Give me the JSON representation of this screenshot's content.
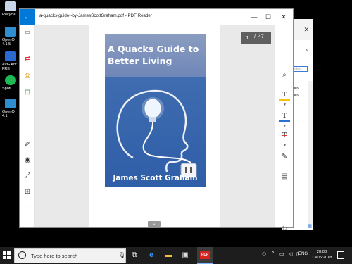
{
  "desktop": {
    "icons": [
      {
        "label": "Recycle",
        "color": "#c8d6e8"
      },
      {
        "label": "OpenO 4.1.5",
        "color": "#2e8ece"
      },
      {
        "label": "AVG Ant FRE",
        "color": "#2b6bd0"
      },
      {
        "label": "Spoti",
        "color": "#1db954"
      },
      {
        "label": "OpenO 4.1.",
        "color": "#2e8ece"
      }
    ]
  },
  "background_window": {
    "close": "✕",
    "arrow": "∨",
    "search_placeholder": "etter...",
    "rows": [
      "1 KB",
      "4 KB"
    ]
  },
  "pdf_window": {
    "back_glyph": "←",
    "title": "a-quacks-guide--by-JamesScottGraham.pdf - PDF Reader",
    "minimize": "—",
    "maximize": "☐",
    "close": "✕",
    "page_current": "1",
    "page_separator": "/",
    "page_total": "47",
    "scroll_handle": "⌄",
    "left_tools": [
      {
        "name": "thumbnail-icon",
        "glyph": "▭"
      },
      {
        "name": "convert-icon",
        "glyph": "⇄"
      },
      {
        "name": "print-icon",
        "glyph": "⎙"
      },
      {
        "name": "share-icon",
        "glyph": "⊡"
      },
      {
        "name": "annotate-icon",
        "glyph": "✐"
      },
      {
        "name": "view-icon",
        "glyph": "◉"
      },
      {
        "name": "expand-icon",
        "glyph": "⤢"
      },
      {
        "name": "grid-icon",
        "glyph": "⊞"
      },
      {
        "name": "more-icon",
        "glyph": "···"
      }
    ],
    "right_tools": [
      {
        "name": "search-icon",
        "glyph": "⌕"
      },
      {
        "name": "highlight-text-icon",
        "glyph": "T"
      },
      {
        "name": "underline-text-icon",
        "glyph": "T"
      },
      {
        "name": "strikethrough-text-icon",
        "glyph": "T"
      },
      {
        "name": "pen-icon",
        "glyph": "✎"
      },
      {
        "name": "note-icon",
        "glyph": "▤"
      },
      {
        "name": "bookmark-icon",
        "glyph": "⚐"
      }
    ],
    "cover": {
      "title": "A Quacks Guide to Better Living",
      "author": "James Scott Graham"
    }
  },
  "taskbar": {
    "search_placeholder": "Type here to search",
    "mic": "🎙",
    "icons": [
      "task-view-icon",
      "edge-icon",
      "file-explorer-icon",
      "store-icon"
    ],
    "pdf_label": "PDF",
    "tray": {
      "language": "ENG",
      "time": "20:00",
      "date": "13/05/2018"
    }
  },
  "colors": {
    "accent": "#0078d7",
    "highlight_yellow": "#f4c20d",
    "cover_blue": "#2f5ea8"
  }
}
